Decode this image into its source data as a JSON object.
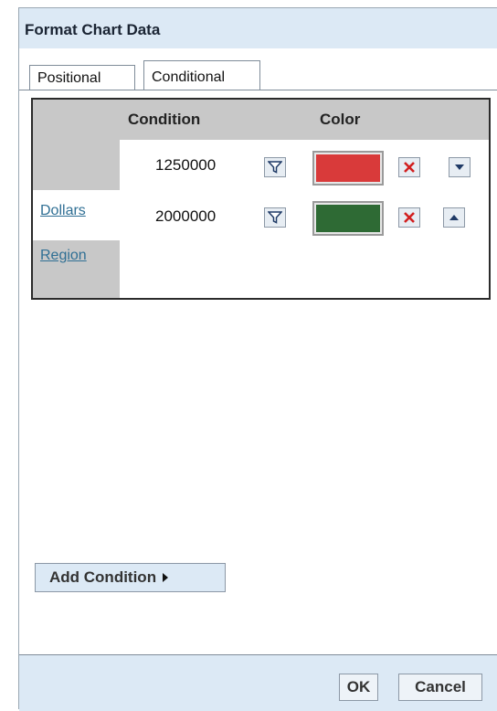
{
  "dialog": {
    "title": "Format Chart Data"
  },
  "tabs": [
    {
      "label": "Positional",
      "active": false
    },
    {
      "label": "Conditional",
      "active": true
    }
  ],
  "table": {
    "headers": {
      "condition": "Condition",
      "color": "Color"
    },
    "rows": [
      {
        "value": "1250000",
        "color": "#d93a3a",
        "move": "down"
      },
      {
        "value": "2000000",
        "color": "#2e6a34",
        "move": "up"
      }
    ]
  },
  "fields": [
    "Dollars",
    "Region"
  ],
  "buttons": {
    "add_condition": "Add Condition",
    "ok": "OK",
    "cancel": "Cancel"
  },
  "icons": {
    "filter": "filter-icon",
    "delete": "delete-icon",
    "move_down": "arrow-down-icon",
    "move_up": "arrow-up-icon",
    "submenu": "triangle-right-icon"
  }
}
